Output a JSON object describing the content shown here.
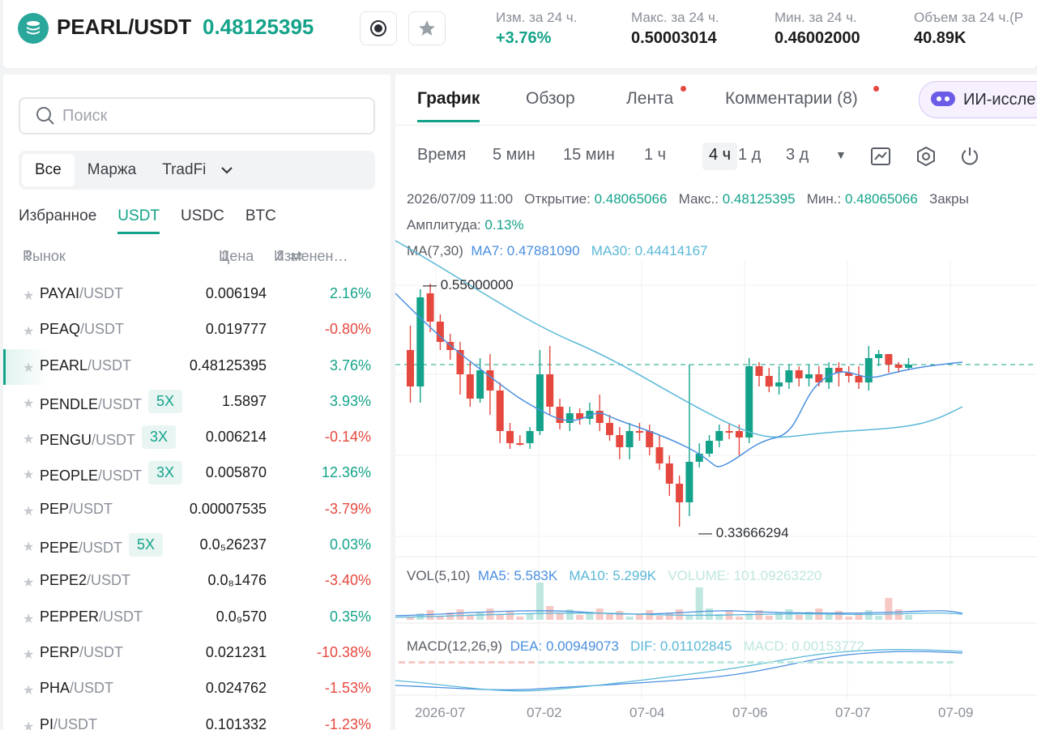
{
  "header": {
    "pair": "PEARL/USDT",
    "price": "0.48125395",
    "stats": [
      {
        "label": "Изм. за 24 ч.",
        "value": "+3.76%",
        "color": "green"
      },
      {
        "label": "Макс. за 24 ч.",
        "value": "0.50003014",
        "color": "dark"
      },
      {
        "label": "Мин. за 24 ч.",
        "value": "0.46002000",
        "color": "dark"
      },
      {
        "label": "Объем за 24 ч.(P",
        "value": "40.89K",
        "color": "dark"
      }
    ]
  },
  "left": {
    "search_placeholder": "Поиск",
    "segments": [
      "Все",
      "Маржа",
      "TradFi"
    ],
    "quote_tabs": [
      "Избранное",
      "USDT",
      "USDC",
      "BTC"
    ],
    "col_market": "Рынок",
    "col_price": "Цена",
    "col_change": "Изменен…",
    "rows": [
      {
        "base": "PAYAI",
        "quote": "/USDT",
        "lev": "",
        "price": "0.006194",
        "change": "2.16%",
        "dir": "up"
      },
      {
        "base": "PEAQ",
        "quote": "/USDT",
        "lev": "",
        "price": "0.019777",
        "change": "-0.80%",
        "dir": "down"
      },
      {
        "base": "PEARL",
        "quote": "/USDT",
        "lev": "",
        "price": "0.48125395",
        "change": "3.76%",
        "dir": "up",
        "active": true
      },
      {
        "base": "PENDLE",
        "quote": "/USDT",
        "lev": "5X",
        "price": "1.5897",
        "change": "3.93%",
        "dir": "up"
      },
      {
        "base": "PENGU",
        "quote": "/USDT",
        "lev": "3X",
        "price": "0.006214",
        "change": "-0.14%",
        "dir": "down"
      },
      {
        "base": "PEOPLE",
        "quote": "/USDT",
        "lev": "3X",
        "price": "0.005870",
        "change": "12.36%",
        "dir": "up"
      },
      {
        "base": "PEP",
        "quote": "/USDT",
        "lev": "",
        "price": "0.00007535",
        "change": "-3.79%",
        "dir": "down"
      },
      {
        "base": "PEPE",
        "quote": "/USDT",
        "lev": "5X",
        "price": "0.0₅26237",
        "change": "0.03%",
        "dir": "up"
      },
      {
        "base": "PEPE2",
        "quote": "/USDT",
        "lev": "",
        "price": "0.0₈1476",
        "change": "-3.40%",
        "dir": "down"
      },
      {
        "base": "PEPPER",
        "quote": "/USDT",
        "lev": "",
        "price": "0.0₉570",
        "change": "0.35%",
        "dir": "up"
      },
      {
        "base": "PERP",
        "quote": "/USDT",
        "lev": "",
        "price": "0.021231",
        "change": "-10.38%",
        "dir": "down"
      },
      {
        "base": "PHA",
        "quote": "/USDT",
        "lev": "",
        "price": "0.024762",
        "change": "-1.53%",
        "dir": "down"
      },
      {
        "base": "PI",
        "quote": "/USDT",
        "lev": "",
        "price": "0.101332",
        "change": "-1.23%",
        "dir": "down"
      }
    ]
  },
  "chart": {
    "tabs": [
      "График",
      "Обзор",
      "Лента",
      "Комментарии (8)"
    ],
    "ai_label": "ИИ-иссле",
    "timeframes": [
      "Время",
      "5 мин",
      "15 мин",
      "1 ч",
      "4 ч",
      "1 д",
      "3 д"
    ],
    "active_tf": "4 ч",
    "ohlc": {
      "time": "2026/07/09 11:00",
      "open_label": "Открытие:",
      "open": "0.48065066",
      "high_label": "Макс.:",
      "high": "0.48125395",
      "low_label": "Мин.:",
      "low": "0.48065066",
      "close_label": "Закры",
      "amp_label": "Амплитуда:",
      "amp": "0.13%"
    },
    "ma": {
      "label": "MA(7,30)",
      "ma7_label": "MA7:",
      "ma7": "0.47881090",
      "ma30_label": "MA30:",
      "ma30": "0.44414167"
    },
    "high_marker": "0.55000000",
    "low_marker": "0.33666294",
    "vol": {
      "label": "VOL(5,10)",
      "ma5_label": "MA5:",
      "ma5": "5.583K",
      "ma10_label": "MA10:",
      "ma10": "5.299K",
      "volume_label": "VOLUME:",
      "volume": "101.09263220"
    },
    "macd": {
      "label": "MACD(12,26,9)",
      "dea_label": "DEA:",
      "dea": "0.00949073",
      "dif_label": "DIF:",
      "dif": "0.01102845",
      "macd_label": "MACD:",
      "macd": "0.00153772"
    },
    "x_labels": [
      "2026-07",
      "07-02",
      "07-04",
      "07-06",
      "07-07",
      "07-09"
    ],
    "colors": {
      "up": "#14a38a",
      "down": "#e5483e",
      "ma7": "#4a8fe0",
      "ma30": "#5ab8d8"
    }
  }
}
